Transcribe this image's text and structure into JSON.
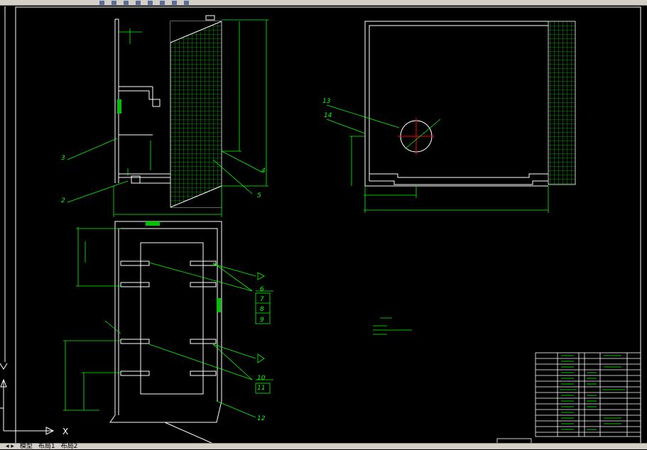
{
  "callouts": {
    "c2": "2",
    "c3": "3",
    "c4": "4",
    "c5": "5",
    "c6": "6",
    "c7": "7",
    "c8": "8",
    "c9": "9",
    "c10": "10",
    "c11": "11",
    "c12": "12",
    "c13": "13",
    "c14": "14"
  },
  "layout_tabs": [
    "模型",
    "布局1",
    "布局2"
  ],
  "ucs": {
    "x_label": "X"
  },
  "colors": {
    "background": "#000000",
    "line": "#ffffff",
    "dim": "#00ff00",
    "center": "#ff0000",
    "hatch": "#00c000"
  }
}
